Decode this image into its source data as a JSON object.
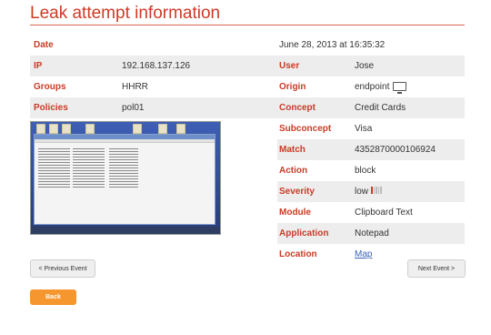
{
  "page": {
    "title": "Leak attempt information"
  },
  "date": {
    "label": "Date",
    "value": "June 28, 2013 at 16:35:32"
  },
  "left_rows": [
    {
      "label": "IP",
      "value": "192.168.137.126"
    },
    {
      "label": "Groups",
      "value": "HHRR"
    },
    {
      "label": "Policies",
      "value": "pol01"
    }
  ],
  "right_rows": [
    {
      "label": "User",
      "value": "Jose"
    },
    {
      "label": "Origin",
      "value": "endpoint",
      "icon": "monitor-icon"
    },
    {
      "label": "Concept",
      "value": "Credit Cards"
    },
    {
      "label": "Subconcept",
      "value": "Visa"
    },
    {
      "label": "Match",
      "value": "4352870000106924"
    },
    {
      "label": "Action",
      "value": "block"
    },
    {
      "label": "Severity",
      "value": "low",
      "severity_level": 0.2
    },
    {
      "label": "Module",
      "value": "Clipboard Text"
    },
    {
      "label": "Application",
      "value": "Notepad"
    },
    {
      "label": "Location",
      "value": "Map"
    }
  ],
  "buttons": {
    "previous": "< Previous Event",
    "next": "Next Event >",
    "back": "Back"
  },
  "colors": {
    "accent": "#c93b26",
    "back_button": "#f5962f",
    "link": "#3b62b6"
  }
}
